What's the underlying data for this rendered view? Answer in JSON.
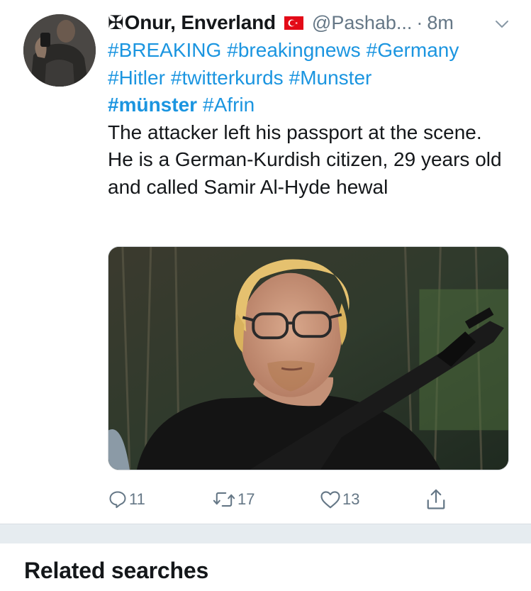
{
  "tweet": {
    "author_prefix": "✠",
    "author_name": "Onur, Enverland",
    "flag_icon": "turkey-flag-icon",
    "handle": "@Pashab...",
    "separator": "·",
    "time": "8m",
    "hashtags_line1": [
      "#BREAKING",
      "#breakingnews",
      "#Germany"
    ],
    "hashtags_line2": [
      "#Hitler",
      "#twitterkurds",
      "#Munster"
    ],
    "hashtags_line3": [
      "#münster",
      "#Afrin"
    ],
    "text": "The attacker left his passport at the scene. He is a German-Kurdish citizen, 29 years old and called Samir Al-Hyde hewal",
    "actions": {
      "reply_count": "11",
      "retweet_count": "17",
      "like_count": "13"
    }
  },
  "related": {
    "title": "Related searches"
  },
  "colors": {
    "link": "#1b95e0",
    "muted": "#657786",
    "divider": "#e6ecf0"
  }
}
